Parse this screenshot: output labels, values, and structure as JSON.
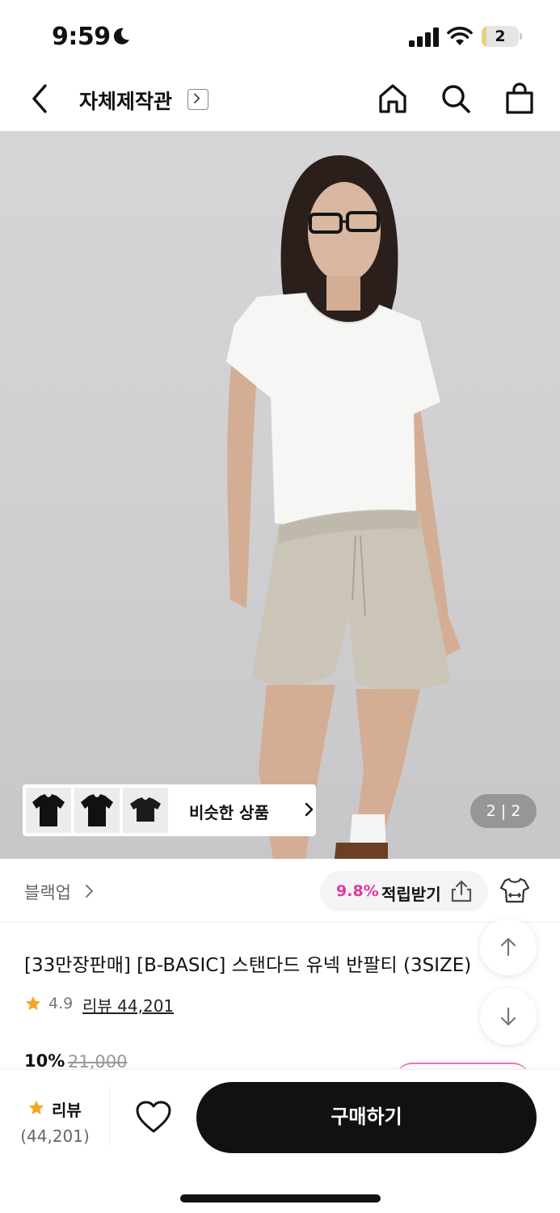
{
  "status_bar": {
    "time": "9:59",
    "battery_level": "2",
    "battery_fraction": 0.02,
    "icons": [
      "moon-icon",
      "signal-icon",
      "wifi-icon",
      "battery-icon"
    ]
  },
  "nav": {
    "store_title": "자체제작관",
    "icons": [
      "back-icon",
      "chevron-right-icon",
      "home-icon",
      "search-icon",
      "shopping-bag-icon"
    ]
  },
  "hero": {
    "similar_label": "비슷한 상품",
    "page_indicator": "2 | 2",
    "thumb_colors": [
      "#111111",
      "#111111",
      "#1c1c1c"
    ]
  },
  "brand": {
    "name": "블랙업",
    "point_rate": "9.8%",
    "point_label": "적립받기",
    "icons": [
      "chevron-right-icon",
      "share-icon",
      "fitting-icon"
    ]
  },
  "product": {
    "title": "[33만장판매] [B-BASIC] 스탠다드 유넥 반팔티 (3SIZE)",
    "rating": "4.9",
    "review_link": "리뷰 44,201",
    "discount": "10%",
    "original_price": "21,000"
  },
  "bottom_bar": {
    "review_label": "리뷰",
    "review_count": "(44,201)",
    "buy_label": "구매하기",
    "icons": [
      "star-icon",
      "heart-icon"
    ]
  },
  "colors": {
    "accent_pink": "#e0389e",
    "star": "#f5a623",
    "buy_button": "#111111"
  }
}
